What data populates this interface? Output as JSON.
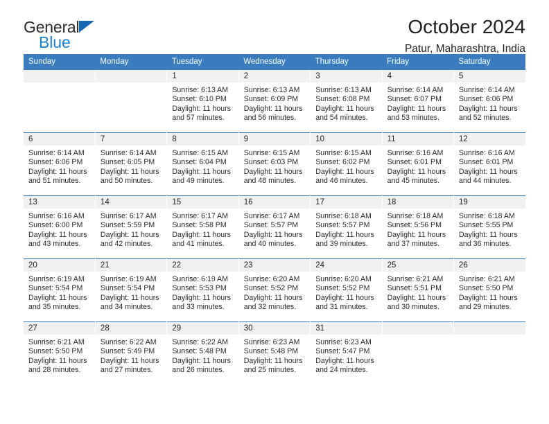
{
  "brand": {
    "name_part1": "General",
    "name_part2": "Blue",
    "triangle_color": "#1567b3",
    "blue_color": "#1b81d4"
  },
  "header": {
    "title": "October 2024",
    "location": "Patur, Maharashtra, India"
  },
  "colors": {
    "header_row_bg": "#3a7cbe",
    "header_row_text": "#ffffff",
    "daynum_band_bg": "#f0f0f0",
    "cell_bg": "#ffffff",
    "row_rule": "#3a7cbe",
    "text": "#2a2a2a"
  },
  "weekday_headers": [
    "Sunday",
    "Monday",
    "Tuesday",
    "Wednesday",
    "Thursday",
    "Friday",
    "Saturday"
  ],
  "labels": {
    "sunrise_prefix": "Sunrise:",
    "sunset_prefix": "Sunset:",
    "daylight_prefix": "Daylight:"
  },
  "weeks": [
    [
      {
        "day": "",
        "sunrise": "",
        "sunset": "",
        "daylight_l1": "",
        "daylight_l2": "",
        "empty": true
      },
      {
        "day": "",
        "sunrise": "",
        "sunset": "",
        "daylight_l1": "",
        "daylight_l2": "",
        "empty": true
      },
      {
        "day": "1",
        "sunrise": "Sunrise: 6:13 AM",
        "sunset": "Sunset: 6:10 PM",
        "daylight_l1": "Daylight: 11 hours",
        "daylight_l2": "and 57 minutes.",
        "empty": false
      },
      {
        "day": "2",
        "sunrise": "Sunrise: 6:13 AM",
        "sunset": "Sunset: 6:09 PM",
        "daylight_l1": "Daylight: 11 hours",
        "daylight_l2": "and 56 minutes.",
        "empty": false
      },
      {
        "day": "3",
        "sunrise": "Sunrise: 6:13 AM",
        "sunset": "Sunset: 6:08 PM",
        "daylight_l1": "Daylight: 11 hours",
        "daylight_l2": "and 54 minutes.",
        "empty": false
      },
      {
        "day": "4",
        "sunrise": "Sunrise: 6:14 AM",
        "sunset": "Sunset: 6:07 PM",
        "daylight_l1": "Daylight: 11 hours",
        "daylight_l2": "and 53 minutes.",
        "empty": false
      },
      {
        "day": "5",
        "sunrise": "Sunrise: 6:14 AM",
        "sunset": "Sunset: 6:06 PM",
        "daylight_l1": "Daylight: 11 hours",
        "daylight_l2": "and 52 minutes.",
        "empty": false
      }
    ],
    [
      {
        "day": "6",
        "sunrise": "Sunrise: 6:14 AM",
        "sunset": "Sunset: 6:06 PM",
        "daylight_l1": "Daylight: 11 hours",
        "daylight_l2": "and 51 minutes.",
        "empty": false
      },
      {
        "day": "7",
        "sunrise": "Sunrise: 6:14 AM",
        "sunset": "Sunset: 6:05 PM",
        "daylight_l1": "Daylight: 11 hours",
        "daylight_l2": "and 50 minutes.",
        "empty": false
      },
      {
        "day": "8",
        "sunrise": "Sunrise: 6:15 AM",
        "sunset": "Sunset: 6:04 PM",
        "daylight_l1": "Daylight: 11 hours",
        "daylight_l2": "and 49 minutes.",
        "empty": false
      },
      {
        "day": "9",
        "sunrise": "Sunrise: 6:15 AM",
        "sunset": "Sunset: 6:03 PM",
        "daylight_l1": "Daylight: 11 hours",
        "daylight_l2": "and 48 minutes.",
        "empty": false
      },
      {
        "day": "10",
        "sunrise": "Sunrise: 6:15 AM",
        "sunset": "Sunset: 6:02 PM",
        "daylight_l1": "Daylight: 11 hours",
        "daylight_l2": "and 46 minutes.",
        "empty": false
      },
      {
        "day": "11",
        "sunrise": "Sunrise: 6:16 AM",
        "sunset": "Sunset: 6:01 PM",
        "daylight_l1": "Daylight: 11 hours",
        "daylight_l2": "and 45 minutes.",
        "empty": false
      },
      {
        "day": "12",
        "sunrise": "Sunrise: 6:16 AM",
        "sunset": "Sunset: 6:01 PM",
        "daylight_l1": "Daylight: 11 hours",
        "daylight_l2": "and 44 minutes.",
        "empty": false
      }
    ],
    [
      {
        "day": "13",
        "sunrise": "Sunrise: 6:16 AM",
        "sunset": "Sunset: 6:00 PM",
        "daylight_l1": "Daylight: 11 hours",
        "daylight_l2": "and 43 minutes.",
        "empty": false
      },
      {
        "day": "14",
        "sunrise": "Sunrise: 6:17 AM",
        "sunset": "Sunset: 5:59 PM",
        "daylight_l1": "Daylight: 11 hours",
        "daylight_l2": "and 42 minutes.",
        "empty": false
      },
      {
        "day": "15",
        "sunrise": "Sunrise: 6:17 AM",
        "sunset": "Sunset: 5:58 PM",
        "daylight_l1": "Daylight: 11 hours",
        "daylight_l2": "and 41 minutes.",
        "empty": false
      },
      {
        "day": "16",
        "sunrise": "Sunrise: 6:17 AM",
        "sunset": "Sunset: 5:57 PM",
        "daylight_l1": "Daylight: 11 hours",
        "daylight_l2": "and 40 minutes.",
        "empty": false
      },
      {
        "day": "17",
        "sunrise": "Sunrise: 6:18 AM",
        "sunset": "Sunset: 5:57 PM",
        "daylight_l1": "Daylight: 11 hours",
        "daylight_l2": "and 39 minutes.",
        "empty": false
      },
      {
        "day": "18",
        "sunrise": "Sunrise: 6:18 AM",
        "sunset": "Sunset: 5:56 PM",
        "daylight_l1": "Daylight: 11 hours",
        "daylight_l2": "and 37 minutes.",
        "empty": false
      },
      {
        "day": "19",
        "sunrise": "Sunrise: 6:18 AM",
        "sunset": "Sunset: 5:55 PM",
        "daylight_l1": "Daylight: 11 hours",
        "daylight_l2": "and 36 minutes.",
        "empty": false
      }
    ],
    [
      {
        "day": "20",
        "sunrise": "Sunrise: 6:19 AM",
        "sunset": "Sunset: 5:54 PM",
        "daylight_l1": "Daylight: 11 hours",
        "daylight_l2": "and 35 minutes.",
        "empty": false
      },
      {
        "day": "21",
        "sunrise": "Sunrise: 6:19 AM",
        "sunset": "Sunset: 5:54 PM",
        "daylight_l1": "Daylight: 11 hours",
        "daylight_l2": "and 34 minutes.",
        "empty": false
      },
      {
        "day": "22",
        "sunrise": "Sunrise: 6:19 AM",
        "sunset": "Sunset: 5:53 PM",
        "daylight_l1": "Daylight: 11 hours",
        "daylight_l2": "and 33 minutes.",
        "empty": false
      },
      {
        "day": "23",
        "sunrise": "Sunrise: 6:20 AM",
        "sunset": "Sunset: 5:52 PM",
        "daylight_l1": "Daylight: 11 hours",
        "daylight_l2": "and 32 minutes.",
        "empty": false
      },
      {
        "day": "24",
        "sunrise": "Sunrise: 6:20 AM",
        "sunset": "Sunset: 5:52 PM",
        "daylight_l1": "Daylight: 11 hours",
        "daylight_l2": "and 31 minutes.",
        "empty": false
      },
      {
        "day": "25",
        "sunrise": "Sunrise: 6:21 AM",
        "sunset": "Sunset: 5:51 PM",
        "daylight_l1": "Daylight: 11 hours",
        "daylight_l2": "and 30 minutes.",
        "empty": false
      },
      {
        "day": "26",
        "sunrise": "Sunrise: 6:21 AM",
        "sunset": "Sunset: 5:50 PM",
        "daylight_l1": "Daylight: 11 hours",
        "daylight_l2": "and 29 minutes.",
        "empty": false
      }
    ],
    [
      {
        "day": "27",
        "sunrise": "Sunrise: 6:21 AM",
        "sunset": "Sunset: 5:50 PM",
        "daylight_l1": "Daylight: 11 hours",
        "daylight_l2": "and 28 minutes.",
        "empty": false
      },
      {
        "day": "28",
        "sunrise": "Sunrise: 6:22 AM",
        "sunset": "Sunset: 5:49 PM",
        "daylight_l1": "Daylight: 11 hours",
        "daylight_l2": "and 27 minutes.",
        "empty": false
      },
      {
        "day": "29",
        "sunrise": "Sunrise: 6:22 AM",
        "sunset": "Sunset: 5:48 PM",
        "daylight_l1": "Daylight: 11 hours",
        "daylight_l2": "and 26 minutes.",
        "empty": false
      },
      {
        "day": "30",
        "sunrise": "Sunrise: 6:23 AM",
        "sunset": "Sunset: 5:48 PM",
        "daylight_l1": "Daylight: 11 hours",
        "daylight_l2": "and 25 minutes.",
        "empty": false
      },
      {
        "day": "31",
        "sunrise": "Sunrise: 6:23 AM",
        "sunset": "Sunset: 5:47 PM",
        "daylight_l1": "Daylight: 11 hours",
        "daylight_l2": "and 24 minutes.",
        "empty": false
      },
      {
        "day": "",
        "sunrise": "",
        "sunset": "",
        "daylight_l1": "",
        "daylight_l2": "",
        "empty": true
      },
      {
        "day": "",
        "sunrise": "",
        "sunset": "",
        "daylight_l1": "",
        "daylight_l2": "",
        "empty": true
      }
    ]
  ]
}
